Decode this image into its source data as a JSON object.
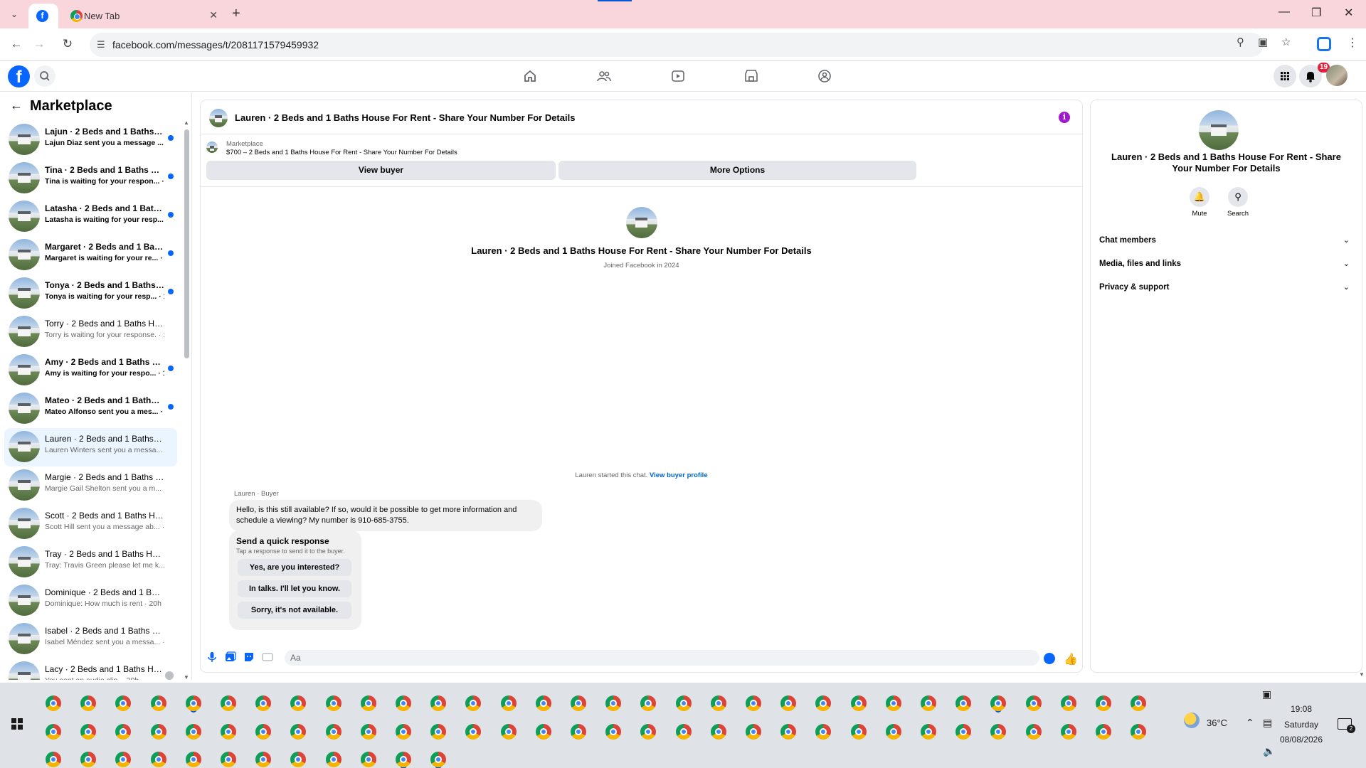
{
  "browser": {
    "tabs": [
      {
        "title": "",
        "active": true
      },
      {
        "title": "New Tab",
        "active": false
      }
    ],
    "url": "facebook.com/messages/t/2081171579459932"
  },
  "fb_header": {
    "notification_count": "19"
  },
  "sidebar": {
    "title": "Marketplace",
    "conversations": [
      {
        "title": "Lajun · 2 Beds and 1 Baths Ho...",
        "preview": "Lajun Diaz sent you a message ... · 2h",
        "unread": true
      },
      {
        "title": "Tina · 2 Beds and 1 Baths Hou...",
        "preview": "Tina is waiting for your respon... · 6h",
        "unread": true
      },
      {
        "title": "Latasha · 2 Beds and 1 Baths ...",
        "preview": "Latasha is waiting for your resp... · 9h",
        "unread": true
      },
      {
        "title": "Margaret · 2 Beds and 1 Baths...",
        "preview": "Margaret is waiting for your re... · 9h",
        "unread": true
      },
      {
        "title": "Tonya · 2 Beds and 1 Baths Ho...",
        "preview": "Tonya is waiting for your resp... · 12h",
        "unread": true
      },
      {
        "title": "Torry · 2 Beds and 1 Baths Hous...",
        "preview": "Torry is waiting for your response. · 12h",
        "unread": false
      },
      {
        "title": "Amy · 2 Beds and 1 Baths Hou...",
        "preview": "Amy is waiting for your respo... · 12h",
        "unread": true
      },
      {
        "title": "Mateo · 2 Beds and 1 Baths H...",
        "preview": "Mateo Alfonso sent you a mes... · 12h",
        "unread": true
      },
      {
        "title": "Lauren · 2 Beds and 1 Baths Ho...",
        "preview": "Lauren Winters sent you a messa... · 12h",
        "unread": false,
        "selected": true
      },
      {
        "title": "Margie · 2 Beds and 1 Baths Ho...",
        "preview": "Margie Gail Shelton sent you a m... · 13h",
        "unread": false
      },
      {
        "title": "Scott · 2 Beds and 1 Baths Hous...",
        "preview": "Scott Hill sent you a message ab... · 16h",
        "unread": false
      },
      {
        "title": "Tray · 2 Beds and 1 Baths House...",
        "preview": "Tray: Travis Green please let me k... · 19h",
        "unread": false
      },
      {
        "title": "Dominique · 2 Beds and 1 Baths...",
        "preview": "Dominique: How much is rent · 20h",
        "unread": false
      },
      {
        "title": "Isabel · 2 Beds and 1 Baths Hou...",
        "preview": "Isabel Méndez sent you a messa... · 20h",
        "unread": false
      },
      {
        "title": "Lacy · 2 Beds and 1 Baths Ho...",
        "preview": "You sent an audio clip. · 20h",
        "unread": false
      }
    ]
  },
  "chat": {
    "title": "Lauren · 2 Beds and 1 Baths House For Rent - Share Your Number For Details",
    "listing_category": "Marketplace",
    "listing_title": "$700 – 2 Beds and 1 Baths House For Rent - Share Your Number For Details",
    "view_buyer_label": "View buyer",
    "more_options_label": "More Options",
    "profile_name": "Lauren · 2 Beds and 1 Baths House For Rent - Share Your Number For Details",
    "joined_text": "Joined Facebook in 2024",
    "started_text": "Lauren started this chat.",
    "view_buyer_profile_label": "View buyer profile",
    "sender_label": "Lauren · Buyer",
    "message": "Hello, is this still available? If so, would it be possible to get more information and schedule a viewing? My number is 910-685-3755.",
    "quick_title": "Send a quick response",
    "quick_subtitle": "Tap a response to send it to the buyer.",
    "quick_responses": [
      "Yes, are you interested?",
      "In talks. I'll let you know.",
      "Sorry, it's not available."
    ],
    "composer_placeholder": "Aa"
  },
  "details": {
    "name": "Lauren · 2 Beds and 1 Baths House For Rent - Share Your Number For Details",
    "mute_label": "Mute",
    "search_label": "Search",
    "sections": [
      "Chat members",
      "Media, files and links",
      "Privacy & support"
    ]
  },
  "taskbar": {
    "weather": "36°C",
    "time": "19:08",
    "day": "Saturday",
    "date": "08/08/2026",
    "notification_count": "2"
  },
  "colors": {
    "tabbar_bg": "#f9d6dc",
    "fb_blue": "#0866ff",
    "selected_row": "#ebf5ff",
    "info_purple": "#a019ce"
  }
}
